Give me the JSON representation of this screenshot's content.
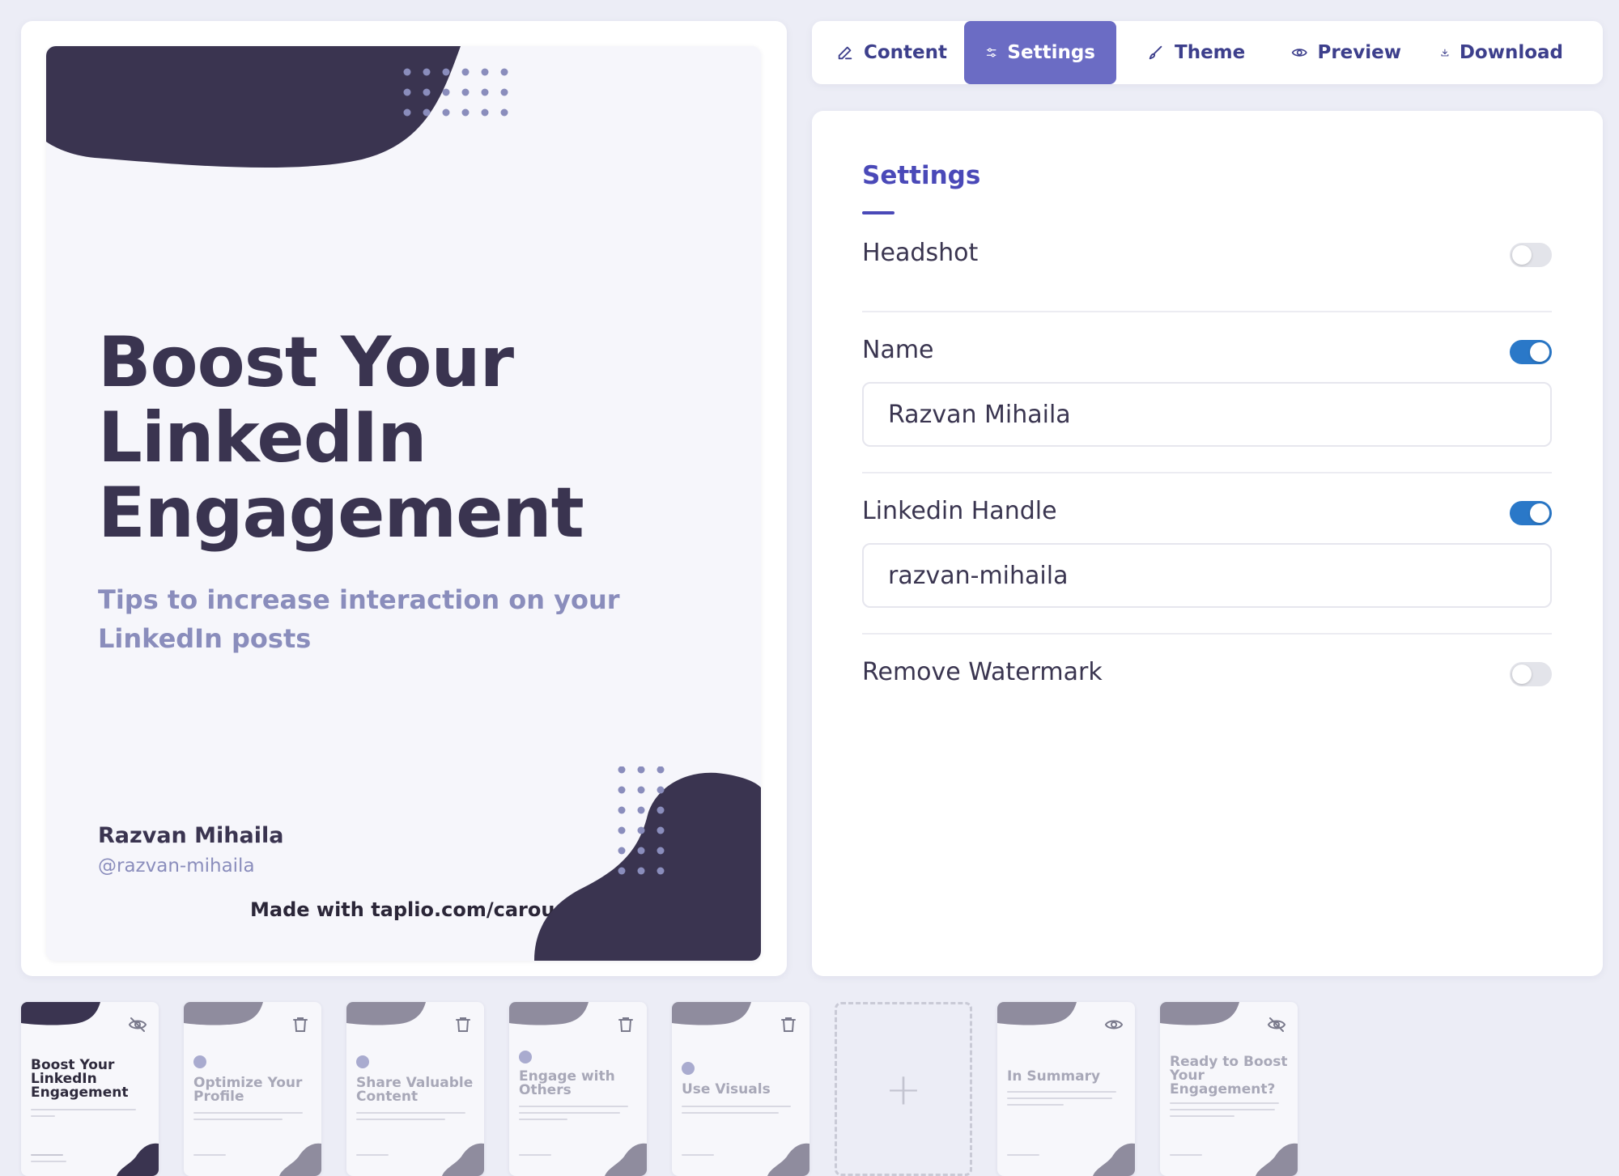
{
  "slide": {
    "title_lines": [
      "Boost Your",
      "LinkedIn",
      "Engagement"
    ],
    "subtitle": "Tips to increase interaction on your LinkedIn posts",
    "name": "Razvan Mihaila",
    "handle": "@razvan-mihaila",
    "watermark": "Made with taplio.com/carouse"
  },
  "tabs": [
    {
      "label": "Content",
      "icon": "pencil-icon",
      "active": false
    },
    {
      "label": "Settings",
      "icon": "sliders-icon",
      "active": true
    },
    {
      "label": "Theme",
      "icon": "brush-icon",
      "active": false
    },
    {
      "label": "Preview",
      "icon": "eye-icon",
      "active": false
    },
    {
      "label": "Download",
      "icon": "download-icon",
      "active": false
    }
  ],
  "settings": {
    "heading": "Settings",
    "headshot": {
      "label": "Headshot",
      "enabled": false
    },
    "name": {
      "label": "Name",
      "enabled": true,
      "value": "Razvan Mihaila"
    },
    "linkedin_handle": {
      "label": "Linkedin Handle",
      "enabled": true,
      "value": "razvan-mihaila"
    },
    "remove_watermark": {
      "label": "Remove Watermark",
      "enabled": false
    }
  },
  "thumbnails": [
    {
      "title": "Boost Your LinkedIn Engagement",
      "icon": "eye-off-icon"
    },
    {
      "title": "Optimize Your Profile",
      "icon": "trash-icon"
    },
    {
      "title": "Share Valuable Content",
      "icon": "trash-icon"
    },
    {
      "title": "Engage with Others",
      "icon": "trash-icon"
    },
    {
      "title": "Use Visuals",
      "icon": "trash-icon"
    },
    {
      "title": "",
      "icon": "plus-icon"
    },
    {
      "title": "In Summary",
      "icon": "eye-icon"
    },
    {
      "title": "Ready to Boost Your Engagement?",
      "icon": "eye-off-icon"
    }
  ],
  "colors": {
    "accent": "#6b6cc4",
    "heading": "#4a49b8",
    "dark_shape": "#3a3450",
    "toggle_on": "#2a78c8"
  }
}
